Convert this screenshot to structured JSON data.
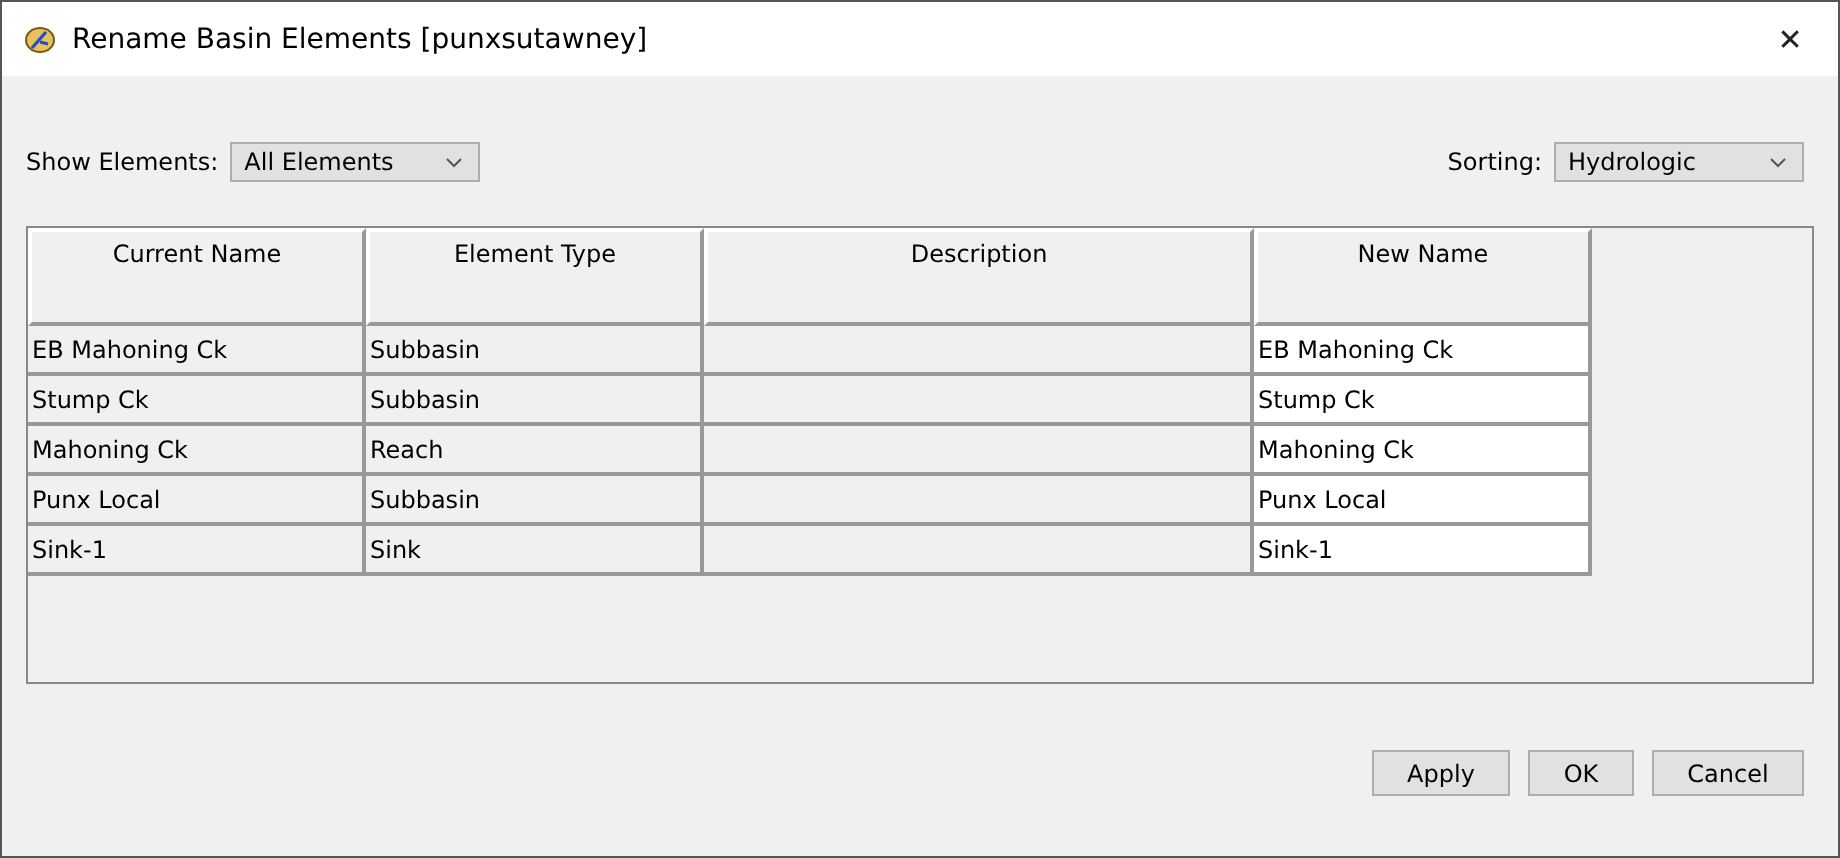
{
  "window": {
    "title": "Rename Basin Elements [punxsutawney]",
    "close": "✕"
  },
  "filters": {
    "show_label": "Show Elements:",
    "show_value": "All Elements",
    "sort_label": "Sorting:",
    "sort_value": "Hydrologic"
  },
  "table": {
    "columns": [
      "Current Name",
      "Element Type",
      "Description",
      "New Name"
    ],
    "rows": [
      {
        "current": "EB Mahoning Ck",
        "type": "Subbasin",
        "description": "",
        "new": "EB Mahoning Ck"
      },
      {
        "current": "Stump Ck",
        "type": "Subbasin",
        "description": "",
        "new": "Stump Ck"
      },
      {
        "current": "Mahoning Ck",
        "type": "Reach",
        "description": "",
        "new": "Mahoning Ck"
      },
      {
        "current": "Punx Local",
        "type": "Subbasin",
        "description": "",
        "new": "Punx Local"
      },
      {
        "current": "Sink-1",
        "type": "Sink",
        "description": "",
        "new": "Sink-1"
      }
    ]
  },
  "buttons": [
    "Apply",
    "OK",
    "Cancel"
  ]
}
